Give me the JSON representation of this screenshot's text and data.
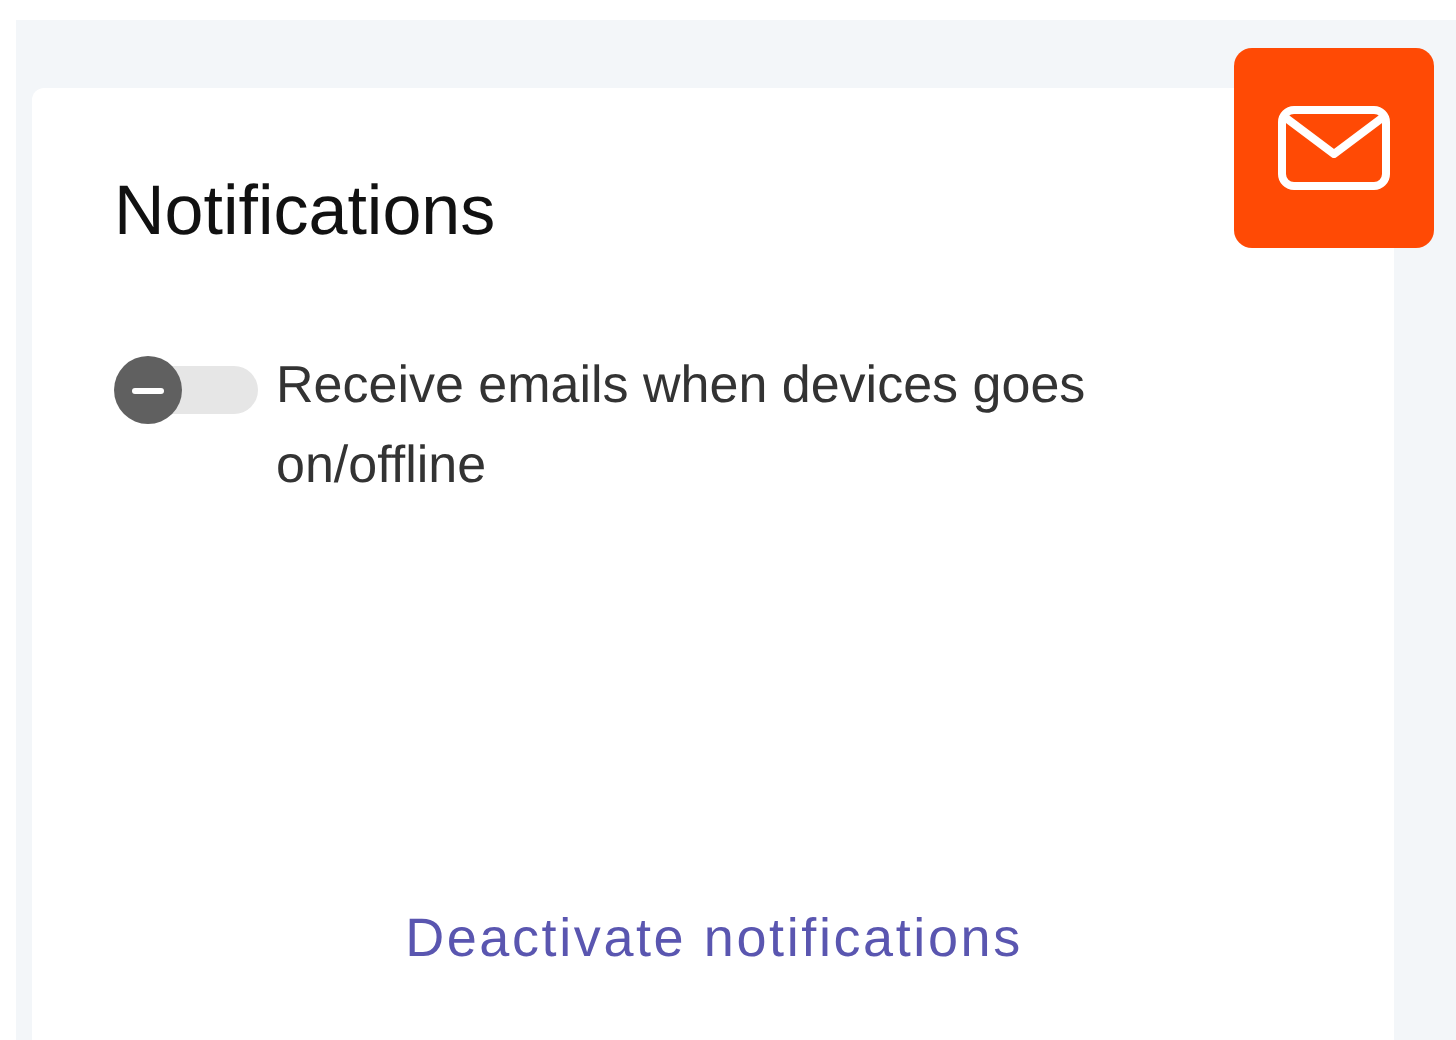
{
  "title": "Notifications",
  "settings": [
    {
      "label": "Receive emails when devices goes on/offline",
      "on": false
    }
  ],
  "link": "Deactivate notifications"
}
